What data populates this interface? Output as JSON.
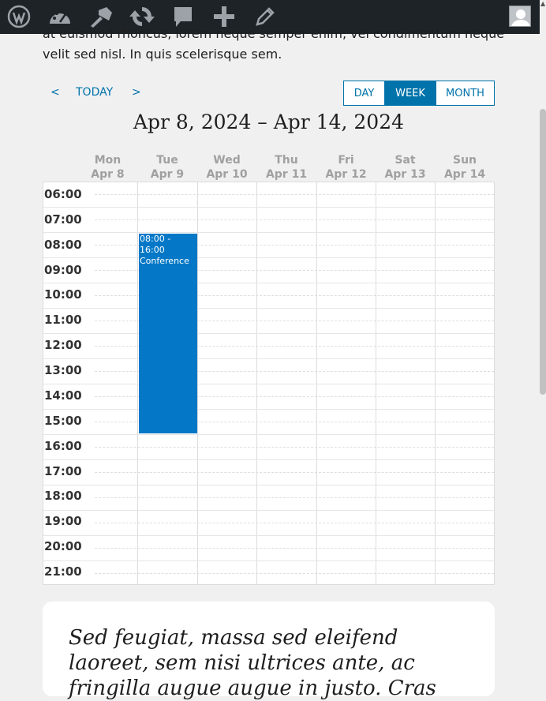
{
  "admin_bar": {
    "icons": [
      "wordpress-logo-icon",
      "dashboard-icon",
      "customize-icon",
      "updates-icon",
      "comments-icon",
      "new-content-icon",
      "edit-icon"
    ]
  },
  "intro": {
    "line1": "at euismod rhoncus, lorem neque semper enim, vel condimentum neque",
    "line2": "velit sed nisl. In quis scelerisque sem."
  },
  "calendar": {
    "prev_label": "<",
    "today_label": "TODAY",
    "next_label": ">",
    "views": {
      "day": "DAY",
      "week": "WEEK",
      "month": "MONTH",
      "active": "WEEK"
    },
    "title": "Apr 8, 2024 – Apr 14, 2024",
    "days": [
      {
        "name": "Mon",
        "date": "Apr 8"
      },
      {
        "name": "Tue",
        "date": "Apr 9"
      },
      {
        "name": "Wed",
        "date": "Apr 10"
      },
      {
        "name": "Thu",
        "date": "Apr 11"
      },
      {
        "name": "Fri",
        "date": "Apr 12"
      },
      {
        "name": "Sat",
        "date": "Apr 13"
      },
      {
        "name": "Sun",
        "date": "Apr 14"
      }
    ],
    "times": [
      "06:00",
      "07:00",
      "08:00",
      "09:00",
      "10:00",
      "11:00",
      "12:00",
      "13:00",
      "14:00",
      "15:00",
      "16:00",
      "17:00",
      "18:00",
      "19:00",
      "20:00",
      "21:00"
    ],
    "event": {
      "time": "08:00 - 16:00",
      "title": "Conference",
      "day": "Tue"
    }
  },
  "card": {
    "text": "Sed feugiat, massa sed eleifend laoreet, sem nisi ultrices ante, ac fringilla augue augue in justo. Cras"
  }
}
